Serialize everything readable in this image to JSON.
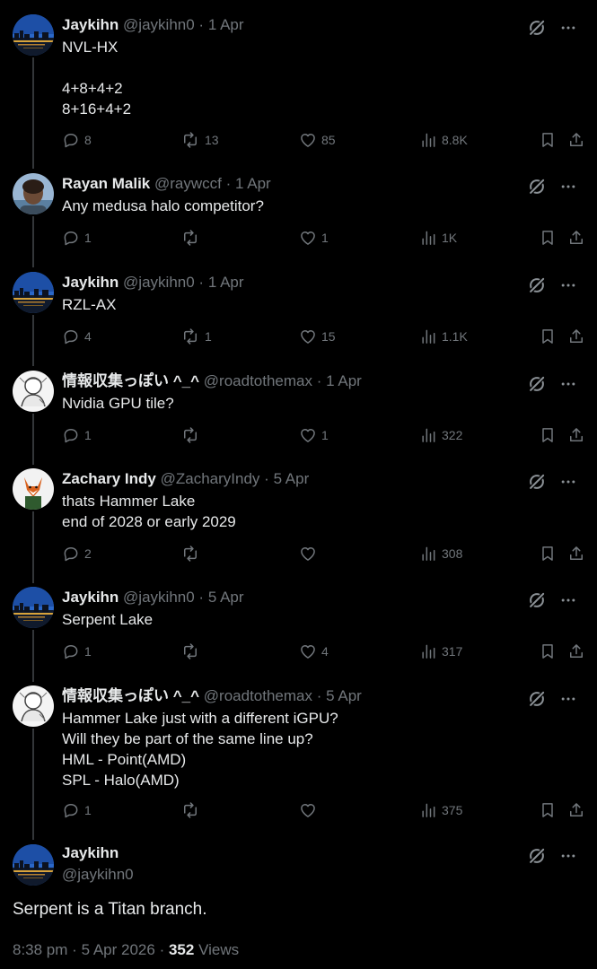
{
  "colors": {
    "background": "#000000",
    "text": "#e7e9ea",
    "muted": "#71767b",
    "thread_line": "#333639"
  },
  "icons": {
    "reply": "reply-icon",
    "repost": "repost-icon",
    "like": "heart-icon",
    "views": "bar-chart-icon",
    "bookmark": "bookmark-icon",
    "share": "share-icon",
    "grok": "grok-icon",
    "more": "more-icon"
  },
  "replies": [
    {
      "name": "Jaykihn",
      "handle": "@jaykihn0",
      "dot": "·",
      "date": "1 Apr",
      "lines": [
        "NVL-HX",
        "",
        "4+8+4+2",
        "8+16+4+2"
      ],
      "reply_count": "8",
      "repost_count": "13",
      "like_count": "85",
      "views": "8.8K"
    },
    {
      "name": "Rayan Malik",
      "handle": "@raywccf",
      "dot": "·",
      "date": "1 Apr",
      "lines": [
        "Any medusa halo competitor?"
      ],
      "reply_count": "1",
      "repost_count": "",
      "like_count": "1",
      "views": "1K"
    },
    {
      "name": "Jaykihn",
      "handle": "@jaykihn0",
      "dot": "·",
      "date": "1 Apr",
      "lines": [
        "RZL-AX"
      ],
      "reply_count": "4",
      "repost_count": "1",
      "like_count": "15",
      "views": "1.1K"
    },
    {
      "name": "情報収集っぽい ^_^",
      "handle": "@roadtothemax",
      "dot": "·",
      "date": "1 Apr",
      "lines": [
        "Nvidia GPU tile?"
      ],
      "reply_count": "1",
      "repost_count": "",
      "like_count": "1",
      "views": "322"
    },
    {
      "name": "Zachary Indy",
      "handle": "@ZacharyIndy",
      "dot": "·",
      "date": "5 Apr",
      "lines": [
        "thats Hammer Lake",
        "end of 2028 or early 2029"
      ],
      "reply_count": "2",
      "repost_count": "",
      "like_count": "",
      "views": "308"
    },
    {
      "name": "Jaykihn",
      "handle": "@jaykihn0",
      "dot": "·",
      "date": "5 Apr",
      "lines": [
        "Serpent Lake"
      ],
      "reply_count": "1",
      "repost_count": "",
      "like_count": "4",
      "views": "317"
    },
    {
      "name": "情報収集っぽい ^_^",
      "handle": "@roadtothemax",
      "dot": "·",
      "date": "5 Apr",
      "lines": [
        "Hammer Lake just with a different iGPU?",
        "Will they be part of the same line up?",
        "HML - Point(AMD)",
        "SPL - Halo(AMD)"
      ],
      "reply_count": "1",
      "repost_count": "",
      "like_count": "",
      "views": "375"
    }
  ],
  "main_tweet": {
    "name": "Jaykihn",
    "handle": "@jaykihn0",
    "text": "Serpent is a Titan branch.",
    "time": "8:38 pm",
    "dot": "·",
    "date": "5 Apr 2026",
    "dot2": "·",
    "views_count": "352",
    "views_label": "Views"
  }
}
